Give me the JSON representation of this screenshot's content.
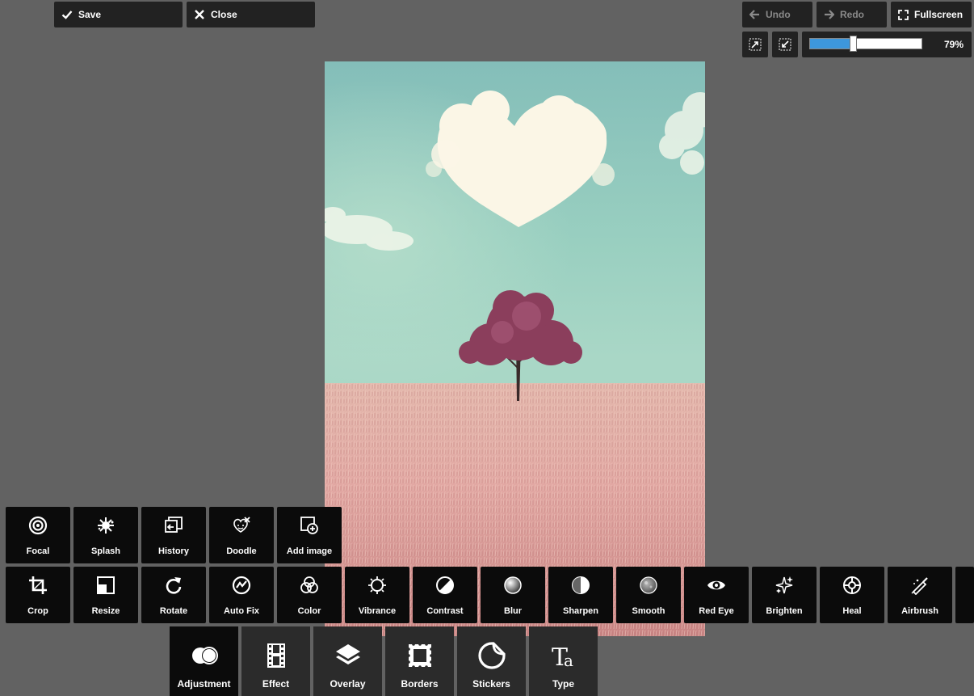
{
  "toolbar": {
    "save_label": "Save",
    "close_label": "Close",
    "undo_label": "Undo",
    "redo_label": "Redo",
    "fullscreen_label": "Fullscreen"
  },
  "zoom": {
    "value": 0.79,
    "label": "79%",
    "fit_icon": "fit-to-screen-icon",
    "actual_size_icon": "actual-size-icon"
  },
  "canvas": {
    "image_description_icon": "photo-heart-cloud-tree-field"
  },
  "tools_row1": [
    {
      "label": "Focal",
      "icon": "focal-icon"
    },
    {
      "label": "Splash",
      "icon": "splash-icon"
    },
    {
      "label": "History",
      "icon": "history-icon"
    },
    {
      "label": "Doodle",
      "icon": "doodle-icon"
    },
    {
      "label": "Add image",
      "icon": "add-image-icon"
    }
  ],
  "tools_row2": [
    {
      "label": "Crop",
      "icon": "crop-icon"
    },
    {
      "label": "Resize",
      "icon": "resize-icon"
    },
    {
      "label": "Rotate",
      "icon": "rotate-icon"
    },
    {
      "label": "Auto Fix",
      "icon": "auto-fix-icon"
    },
    {
      "label": "Color",
      "icon": "color-icon"
    },
    {
      "label": "Vibrance",
      "icon": "vibrance-icon"
    },
    {
      "label": "Contrast",
      "icon": "contrast-icon"
    },
    {
      "label": "Blur",
      "icon": "blur-icon"
    },
    {
      "label": "Sharpen",
      "icon": "sharpen-icon"
    },
    {
      "label": "Smooth",
      "icon": "smooth-icon"
    },
    {
      "label": "Red Eye",
      "icon": "red-eye-icon"
    },
    {
      "label": "Brighten",
      "icon": "brighten-icon"
    },
    {
      "label": "Heal",
      "icon": "heal-icon"
    },
    {
      "label": "Airbrush",
      "icon": "airbrush-icon"
    }
  ],
  "tabs": [
    {
      "label": "Adjustment",
      "icon": "adjustment-icon",
      "active": true
    },
    {
      "label": "Effect",
      "icon": "effect-film-icon",
      "active": false
    },
    {
      "label": "Overlay",
      "icon": "overlay-layers-icon",
      "active": false
    },
    {
      "label": "Borders",
      "icon": "borders-icon",
      "active": false
    },
    {
      "label": "Stickers",
      "icon": "stickers-icon",
      "active": false
    },
    {
      "label": "Type",
      "icon": "type-icon",
      "active": false
    }
  ],
  "colors": {
    "background": "#626262",
    "button": "#222222",
    "tool_tile": "#0b0b0b",
    "tab_inactive": "#2b2b2b",
    "accent": "#3d97dc"
  }
}
